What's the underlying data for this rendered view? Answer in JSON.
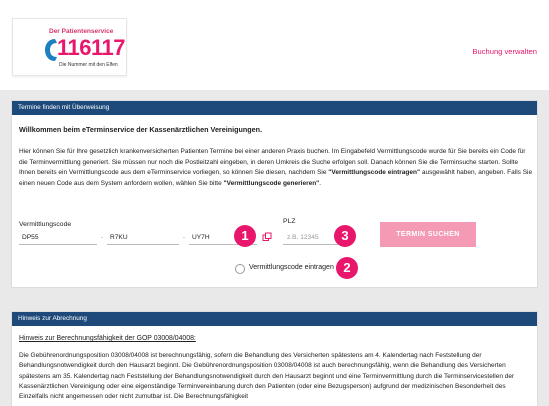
{
  "header": {
    "logo": {
      "top_text": "Der Patientenservice",
      "number": "116117",
      "tagline": "Die Nummer mit den Elfen"
    },
    "booking_link": "Buchung verwalten"
  },
  "search_panel": {
    "title": "Termine finden mit Überweisung",
    "welcome": "Willkommen beim eTerminservice der Kassenärztlichen Vereinigungen.",
    "intro_1": "Hier können Sie für Ihre gesetzlich krankenversicherten Patienten Termine bei einer anderen Praxis buchen. Im Eingabefeld Vermittlungscode wurde für Sie bereits ein Code für die Terminvermittlung generiert. Sie müssen nur noch die Postleitzahl eingeben, in deren Umkreis die Suche erfolgen soll. Danach können Sie die Terminsuche starten. Sollte Ihnen bereits ein Vermittlungscode aus dem eTerminservice vorliegen, so können Sie diesen, nachdem Sie ",
    "intro_bold_1": "\"Vermittlungscode eintragen\"",
    "intro_2": " ausgewählt haben, angeben. Falls Sie einen neuen Code aus dem System anfordern wollen, wählen Sie bitte ",
    "intro_bold_2": "\"Vermittlungscode generieren\"",
    "intro_3": ".",
    "code_label": "Vermittlungscode",
    "code_parts": [
      "DP55",
      "R7KU",
      "UY7H"
    ],
    "separator": ".",
    "plz_label": "PLZ",
    "plz_placeholder": "z.B. 12345",
    "search_button": "TERMIN SUCHEN",
    "radio_label": "Vermittlungscode eintragen",
    "badges": [
      "1",
      "2",
      "3"
    ]
  },
  "hint_panel": {
    "title": "Hinweis zur Abrechnung",
    "subtitle": "Hinweis zur Berechnungsfähigkeit der GOP 03008/04008:",
    "text": "Die Gebührenordnungsposition 03008/04008 ist berechnungsfähig, sofern die Behandlung des Versicherten spätestens am 4. Kalendertag nach Feststellung der Behandlungsnotwendigkeit durch den Hausarzt beginnt. Die Gebührenordnungsposition 03008/04008 ist auch berechnungsfähig, wenn die Behandlung des Versicherten spätestens am 35. Kalendertag nach Feststellung der Behandlungsnotwendigkeit durch den Hausarzt beginnt und eine Terminvermittlung durch die Terminservicestellen der Kassenärztlichen Vereinigung oder eine eigenständige Terminvereinbarung durch den Patienten (oder eine Bezugsperson) aufgrund der medizinischen Besonderheit des Einzelfalls nicht angemessen oder nicht zumutbar ist. Die Berechnungsfähigkeit"
  },
  "colors": {
    "brand_pink": "#e8176b",
    "button_pink": "#f49ab5",
    "panel_header_blue": "#1d4a7a",
    "logo_blue": "#1e7fc0"
  },
  "icons": [
    "phone-icon",
    "copy-icon",
    "radio-icon"
  ]
}
